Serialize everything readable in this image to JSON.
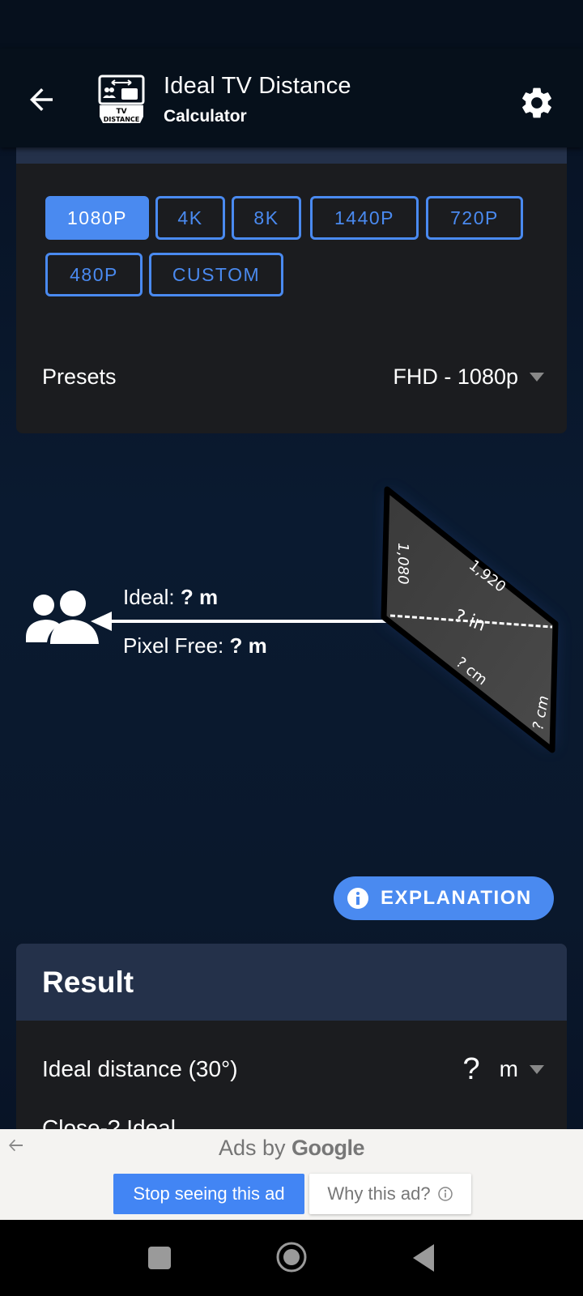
{
  "app_bar": {
    "title": "Ideal TV Distance",
    "subtitle": "Calculator",
    "logo_text_line1": "TV",
    "logo_text_line2": "DISTANCE"
  },
  "resolution": {
    "buttons": [
      {
        "label": "1080P",
        "active": true
      },
      {
        "label": "4K",
        "active": false
      },
      {
        "label": "8K",
        "active": false
      },
      {
        "label": "1440P",
        "active": false
      },
      {
        "label": "720P",
        "active": false
      },
      {
        "label": "480P",
        "active": false
      },
      {
        "label": "CUSTOM",
        "active": false
      }
    ],
    "presets_label": "Presets",
    "presets_value": "FHD - 1080p"
  },
  "illustration": {
    "ideal_label": "Ideal:",
    "ideal_value": "? m",
    "pixel_free_label": "Pixel Free:",
    "pixel_free_value": "? m",
    "tv_width_px": "1,920",
    "tv_height_px": "1,080",
    "tv_diagonal": "? in",
    "tv_width_cm": "? cm",
    "tv_height_cm": "? cm"
  },
  "explanation_button": {
    "label": "EXPLANATION"
  },
  "result": {
    "title": "Result",
    "rows": [
      {
        "label": "Ideal distance (30°)",
        "value": "?",
        "unit": "m"
      }
    ],
    "next_row_partial": "Close-? Ideal..."
  },
  "ad": {
    "ads_by": "Ads by",
    "google": "Google",
    "stop_label": "Stop seeing this ad",
    "why_label": "Why this ad?"
  },
  "colors": {
    "accent": "#4a8af0",
    "card_bg": "#1b1c1f",
    "card_header": "#24314a",
    "app_bar_bg": "#06101b",
    "ad_blue": "#4285f4"
  }
}
